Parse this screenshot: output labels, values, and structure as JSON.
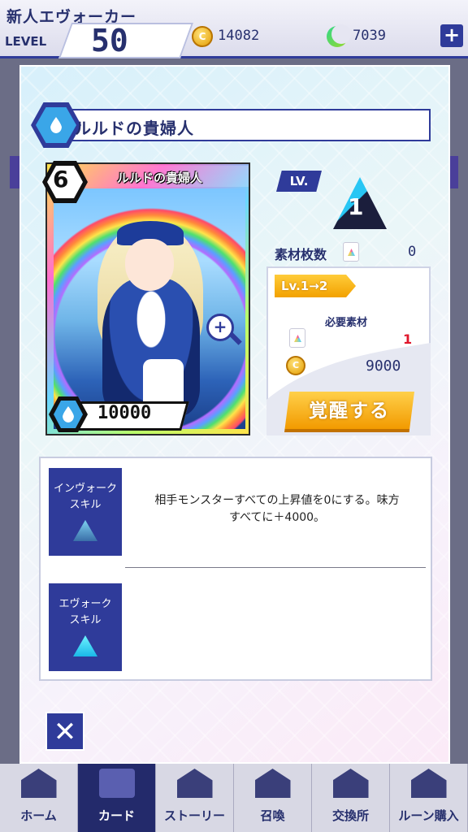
{
  "header": {
    "player_name": "新人エヴォーカー",
    "level_label": "LEVEL",
    "level": "50",
    "coins": "14082",
    "moon_points": "7039",
    "plus_label": "+"
  },
  "card_detail": {
    "title": "ルルドの貴婦人",
    "card": {
      "name": "ルルドの貴婦人",
      "cost": "6",
      "power": "10000",
      "zoom_label": "+"
    },
    "level_tag": "LV.",
    "level": "1",
    "material_label": "素材枚数",
    "material_count": "0",
    "upgrade": {
      "tag": "Lv.1→2",
      "required_title": "必要素材",
      "required_material": "1",
      "coin_symbol": "C",
      "required_coins": "9000",
      "awaken_button": "覚醒する"
    },
    "skills": [
      {
        "label_line1": "インヴォーク",
        "label_line2": "スキル",
        "description_line1": "相手モンスターすべての上昇値を0にする。味方",
        "description_line2": "すべてに＋4000。"
      },
      {
        "label_line1": "エヴォーク",
        "label_line2": "スキル",
        "description_line1": "",
        "description_line2": ""
      }
    ],
    "close_label": "✕"
  },
  "nav": [
    {
      "label": "ホーム"
    },
    {
      "label": "カード"
    },
    {
      "label": "ストーリー"
    },
    {
      "label": "召喚"
    },
    {
      "label": "交換所"
    },
    {
      "label": "ルーン購入"
    }
  ],
  "colors": {
    "primary": "#2f3b9a",
    "accent_gold": "#f2a100",
    "water": "#3aa6e8",
    "required_red": "#e0162b"
  }
}
